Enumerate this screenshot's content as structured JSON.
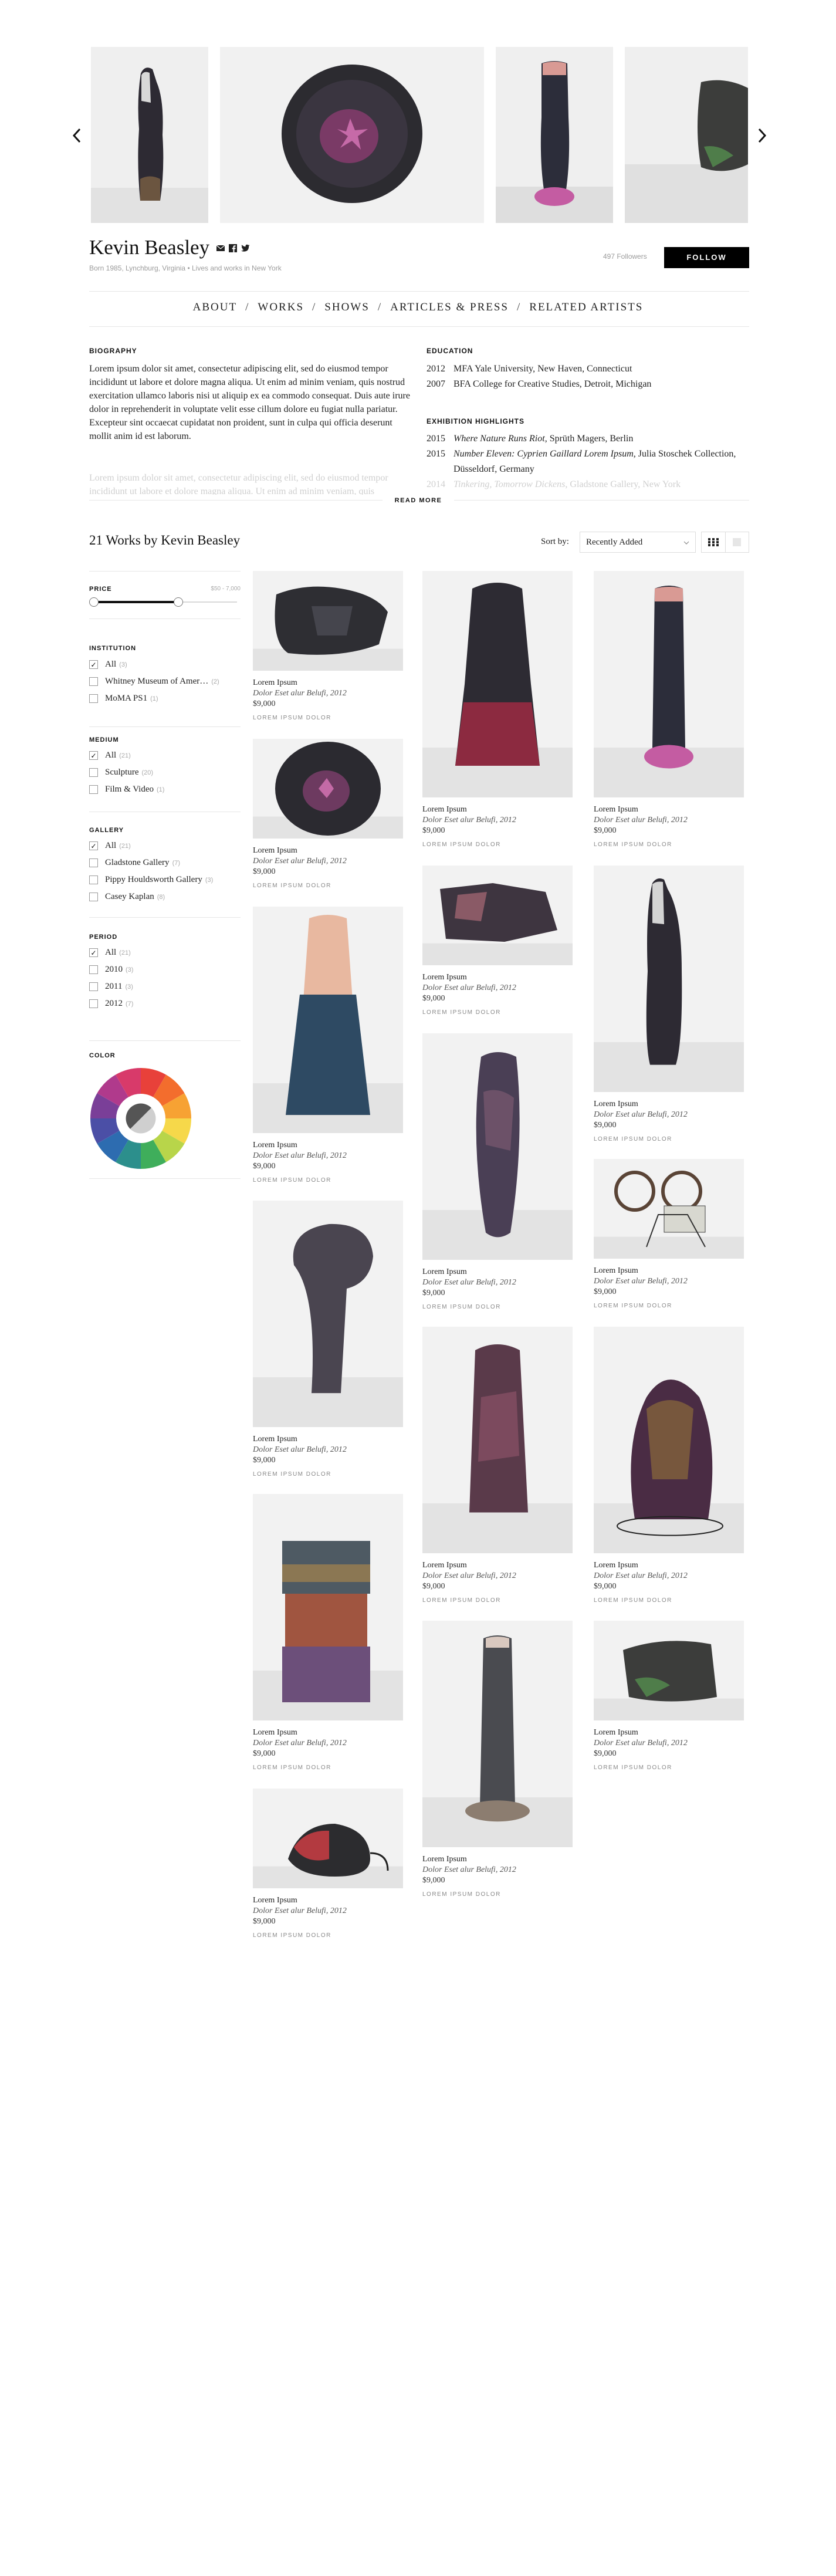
{
  "carousel": {
    "prev_label": "‹",
    "next_label": "›"
  },
  "artist": {
    "name": "Kevin Beasley",
    "bio_line": "Born 1985, Lynchburg, Virginia • Lives and works in New York",
    "followers": "497 Followers",
    "follow_label": "FOLLOW",
    "social_icons": [
      "mail-icon",
      "facebook-icon",
      "twitter-icon"
    ]
  },
  "nav": {
    "items": [
      "ABOUT",
      "WORKS",
      "SHOWS",
      "ARTICLES & PRESS",
      "RELATED ARTISTS"
    ],
    "separator": "/"
  },
  "biography": {
    "heading": "BIOGRAPHY",
    "paragraph1": "Lorem ipsum dolor sit amet, consectetur adipiscing elit, sed do eiusmod tempor incididunt ut labore et dolore magna aliqua. Ut enim ad minim veniam, quis nostrud exercitation ullamco laboris nisi ut aliquip ex ea commodo consequat. Duis aute irure dolor in reprehenderit in voluptate velit esse cillum dolore eu fugiat nulla pariatur. Excepteur sint occaecat cupidatat non proident, sunt in culpa qui officia deserunt mollit anim id est laborum.",
    "paragraph2": "Lorem ipsum dolor sit amet, consectetur adipiscing elit, sed do eiusmod tempor incididunt ut labore et dolore magna aliqua. Ut enim ad minim veniam, quis",
    "read_more": "READ MORE"
  },
  "education": {
    "heading": "EDUCATION",
    "rows": [
      {
        "year": "2012",
        "text": "MFA Yale University, New Haven, Connecticut"
      },
      {
        "year": "2007",
        "text": "BFA College for Creative Studies, Detroit, Michigan"
      }
    ]
  },
  "exhibitions": {
    "heading": "EXHIBITION HIGHLIGHTS",
    "rows": [
      {
        "year": "2015",
        "title": "Where Nature Runs Riot",
        "rest": ", Sprüth Magers, Berlin"
      },
      {
        "year": "2015",
        "title": "Number Eleven: Cyprien Gaillard Lorem Ipsum",
        "rest": ", Julia Stoschek Collection, Düsseldorf, Germany"
      },
      {
        "year": "2014",
        "title": "Tinkering, Tomorrow Dickens",
        "rest": ", Gladstone Gallery, New York"
      }
    ]
  },
  "works": {
    "heading": "21 Works by Kevin Beasley",
    "sort_label": "Sort by:",
    "sort_value": "Recently Added"
  },
  "filters": {
    "price": {
      "title": "PRICE",
      "range": "$50 - 7,000"
    },
    "institution": {
      "title": "INSTITUTION",
      "items": [
        {
          "label": "All",
          "count": "(3)",
          "checked": true
        },
        {
          "label": "Whitney Museum of Amer…",
          "count": "(2)",
          "checked": false
        },
        {
          "label": "MoMA PS1",
          "count": "(1)",
          "checked": false
        }
      ]
    },
    "medium": {
      "title": "MEDIUM",
      "items": [
        {
          "label": "All",
          "count": "(21)",
          "checked": true
        },
        {
          "label": "Sculpture",
          "count": "(20)",
          "checked": false
        },
        {
          "label": "Film & Video",
          "count": "(1)",
          "checked": false
        }
      ]
    },
    "gallery": {
      "title": "GALLERY",
      "items": [
        {
          "label": "All",
          "count": "(21)",
          "checked": true
        },
        {
          "label": "Gladstone Gallery",
          "count": "(7)",
          "checked": false
        },
        {
          "label": "Pippy Houldsworth Gallery",
          "count": "(3)",
          "checked": false
        },
        {
          "label": "Casey Kaplan",
          "count": "(8)",
          "checked": false
        }
      ]
    },
    "period": {
      "title": "PERIOD",
      "items": [
        {
          "label": "All",
          "count": "(21)",
          "checked": true
        },
        {
          "label": "2010",
          "count": "(3)",
          "checked": false
        },
        {
          "label": "2011",
          "count": "(3)",
          "checked": false
        },
        {
          "label": "2012",
          "count": "(7)",
          "checked": false
        }
      ]
    },
    "color": {
      "title": "COLOR",
      "swatches": [
        "#e8413a",
        "#f36d2d",
        "#f7a233",
        "#f6d84a",
        "#b8d54a",
        "#3fae5b",
        "#2c8f8c",
        "#2d6cb0",
        "#4b4fa6",
        "#7a3f98",
        "#b03a8c",
        "#d83a6a"
      ]
    }
  },
  "artwork": {
    "title": "Lorem Ipsum",
    "subtitle": "Dolor Eset alur Belufi, 2012",
    "price": "$9,000",
    "link": "LOREM IPSUM DOLOR"
  }
}
